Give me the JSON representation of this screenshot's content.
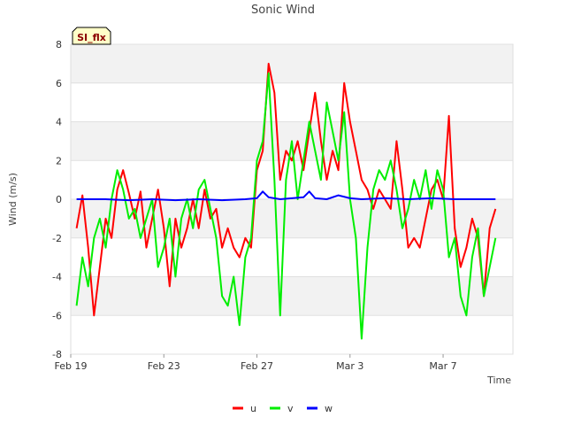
{
  "chart_data": {
    "type": "line",
    "title": "Sonic Wind",
    "xlabel": "Time",
    "ylabel": "Wind (m/s)",
    "badge": "SI_flx",
    "ylim": [
      -8,
      8
    ],
    "xlim": [
      "2023-02-19",
      "2023-03-10"
    ],
    "yticks": [
      -8,
      -6,
      -4,
      -2,
      0,
      2,
      4,
      6,
      8
    ],
    "xticks": [
      {
        "date": "2023-02-19",
        "label": "Feb 19"
      },
      {
        "date": "2023-02-23",
        "label": "Feb 23"
      },
      {
        "date": "2023-02-27",
        "label": "Feb 27"
      },
      {
        "date": "2023-03-03",
        "label": "Mar 3"
      },
      {
        "date": "2023-03-07",
        "label": "Mar 7"
      }
    ],
    "grid": true,
    "legend_position": "bottom",
    "series": [
      {
        "name": "u",
        "color": "#ff0000",
        "x": [
          "2023-02-19T06:00",
          "2023-02-19T12:00",
          "2023-02-19T18:00",
          "2023-02-20T00:00",
          "2023-02-20T06:00",
          "2023-02-20T12:00",
          "2023-02-20T18:00",
          "2023-02-21T00:00",
          "2023-02-21T06:00",
          "2023-02-21T12:00",
          "2023-02-21T18:00",
          "2023-02-22T00:00",
          "2023-02-22T06:00",
          "2023-02-22T12:00",
          "2023-02-22T18:00",
          "2023-02-23T00:00",
          "2023-02-23T06:00",
          "2023-02-23T12:00",
          "2023-02-23T18:00",
          "2023-02-24T00:00",
          "2023-02-24T06:00",
          "2023-02-24T12:00",
          "2023-02-24T18:00",
          "2023-02-25T00:00",
          "2023-02-25T06:00",
          "2023-02-25T12:00",
          "2023-02-25T18:00",
          "2023-02-26T00:00",
          "2023-02-26T06:00",
          "2023-02-26T12:00",
          "2023-02-26T18:00",
          "2023-02-27T00:00",
          "2023-02-27T06:00",
          "2023-02-27T12:00",
          "2023-02-27T18:00",
          "2023-02-28T00:00",
          "2023-02-28T06:00",
          "2023-02-28T12:00",
          "2023-02-28T18:00",
          "2023-03-01T00:00",
          "2023-03-01T06:00",
          "2023-03-01T12:00",
          "2023-03-01T18:00",
          "2023-03-02T00:00",
          "2023-03-02T06:00",
          "2023-03-02T12:00",
          "2023-03-02T18:00",
          "2023-03-03T00:00",
          "2023-03-03T06:00",
          "2023-03-03T12:00",
          "2023-03-03T18:00",
          "2023-03-04T00:00",
          "2023-03-04T06:00",
          "2023-03-04T12:00",
          "2023-03-04T18:00",
          "2023-03-05T00:00",
          "2023-03-05T06:00",
          "2023-03-05T12:00",
          "2023-03-05T18:00",
          "2023-03-06T00:00",
          "2023-03-06T06:00",
          "2023-03-06T12:00",
          "2023-03-06T18:00",
          "2023-03-07T00:00",
          "2023-03-07T06:00",
          "2023-03-07T12:00",
          "2023-03-07T18:00",
          "2023-03-08T00:00",
          "2023-03-08T06:00",
          "2023-03-08T12:00",
          "2023-03-08T18:00",
          "2023-03-09T00:00",
          "2023-03-09T06:00"
        ],
        "values": [
          -1.5,
          0.2,
          -2.5,
          -6.0,
          -3.5,
          -1.0,
          -2.0,
          0.5,
          1.5,
          0.3,
          -1.0,
          0.4,
          -2.5,
          -1.0,
          0.5,
          -1.5,
          -4.5,
          -1.0,
          -2.5,
          -1.5,
          0.0,
          -1.5,
          0.5,
          -1.0,
          -0.5,
          -2.5,
          -1.5,
          -2.5,
          -3.0,
          -2.0,
          -2.5,
          1.5,
          2.5,
          7.0,
          5.5,
          1.0,
          2.5,
          2.0,
          3.0,
          1.5,
          3.5,
          5.5,
          3.0,
          1.0,
          2.5,
          1.5,
          6.0,
          4.0,
          2.5,
          1.0,
          0.5,
          -0.5,
          0.5,
          0.0,
          -0.5,
          3.0,
          0.5,
          -2.5,
          -2.0,
          -2.5,
          -1.0,
          0.5,
          1.0,
          0.0,
          4.3,
          -1.5,
          -3.5,
          -2.5,
          -1.0,
          -2.0,
          -5.0,
          -1.5,
          -0.5
        ]
      },
      {
        "name": "v",
        "color": "#00ee00",
        "x": [
          "2023-02-19T06:00",
          "2023-02-19T12:00",
          "2023-02-19T18:00",
          "2023-02-20T00:00",
          "2023-02-20T06:00",
          "2023-02-20T12:00",
          "2023-02-20T18:00",
          "2023-02-21T00:00",
          "2023-02-21T06:00",
          "2023-02-21T12:00",
          "2023-02-21T18:00",
          "2023-02-22T00:00",
          "2023-02-22T06:00",
          "2023-02-22T12:00",
          "2023-02-22T18:00",
          "2023-02-23T00:00",
          "2023-02-23T06:00",
          "2023-02-23T12:00",
          "2023-02-23T18:00",
          "2023-02-24T00:00",
          "2023-02-24T06:00",
          "2023-02-24T12:00",
          "2023-02-24T18:00",
          "2023-02-25T00:00",
          "2023-02-25T06:00",
          "2023-02-25T12:00",
          "2023-02-25T18:00",
          "2023-02-26T00:00",
          "2023-02-26T06:00",
          "2023-02-26T12:00",
          "2023-02-26T18:00",
          "2023-02-27T00:00",
          "2023-02-27T06:00",
          "2023-02-27T12:00",
          "2023-02-27T18:00",
          "2023-02-28T00:00",
          "2023-02-28T06:00",
          "2023-02-28T12:00",
          "2023-02-28T18:00",
          "2023-03-01T00:00",
          "2023-03-01T06:00",
          "2023-03-01T12:00",
          "2023-03-01T18:00",
          "2023-03-02T00:00",
          "2023-03-02T06:00",
          "2023-03-02T12:00",
          "2023-03-02T18:00",
          "2023-03-03T00:00",
          "2023-03-03T06:00",
          "2023-03-03T12:00",
          "2023-03-03T18:00",
          "2023-03-04T00:00",
          "2023-03-04T06:00",
          "2023-03-04T12:00",
          "2023-03-04T18:00",
          "2023-03-05T00:00",
          "2023-03-05T06:00",
          "2023-03-05T12:00",
          "2023-03-05T18:00",
          "2023-03-06T00:00",
          "2023-03-06T06:00",
          "2023-03-06T12:00",
          "2023-03-06T18:00",
          "2023-03-07T00:00",
          "2023-03-07T06:00",
          "2023-03-07T12:00",
          "2023-03-07T18:00",
          "2023-03-08T00:00",
          "2023-03-08T06:00",
          "2023-03-08T12:00",
          "2023-03-08T18:00",
          "2023-03-09T00:00",
          "2023-03-09T06:00"
        ],
        "values": [
          -5.5,
          -3.0,
          -4.5,
          -2.0,
          -1.0,
          -2.5,
          0.0,
          1.5,
          0.5,
          -1.0,
          -0.5,
          -2.0,
          -1.0,
          0.0,
          -3.5,
          -2.5,
          -1.0,
          -4.0,
          -1.0,
          0.0,
          -1.5,
          0.5,
          1.0,
          -0.5,
          -2.0,
          -5.0,
          -5.5,
          -4.0,
          -6.5,
          -3.0,
          -2.0,
          2.0,
          3.0,
          6.5,
          1.0,
          -6.0,
          1.0,
          3.0,
          0.0,
          2.0,
          4.0,
          2.5,
          1.0,
          5.0,
          3.5,
          2.0,
          4.5,
          0.0,
          -2.0,
          -7.2,
          -2.5,
          0.5,
          1.5,
          1.0,
          2.0,
          0.5,
          -1.5,
          -0.5,
          1.0,
          0.0,
          1.5,
          -0.5,
          1.5,
          0.5,
          -3.0,
          -2.0,
          -5.0,
          -6.0,
          -3.0,
          -1.5,
          -5.0,
          -3.5,
          -2.0
        ]
      },
      {
        "name": "w",
        "color": "#0000ff",
        "x": [
          "2023-02-19T06:00",
          "2023-02-20T12:00",
          "2023-02-21T12:00",
          "2023-02-22T12:00",
          "2023-02-23T12:00",
          "2023-02-24T12:00",
          "2023-02-25T12:00",
          "2023-02-26T12:00",
          "2023-02-27T00:00",
          "2023-02-27T06:00",
          "2023-02-27T12:00",
          "2023-02-28T00:00",
          "2023-02-28T12:00",
          "2023-03-01T00:00",
          "2023-03-01T06:00",
          "2023-03-01T12:00",
          "2023-03-02T00:00",
          "2023-03-02T12:00",
          "2023-03-03T00:00",
          "2023-03-03T12:00",
          "2023-03-04T12:00",
          "2023-03-05T12:00",
          "2023-03-06T12:00",
          "2023-03-07T12:00",
          "2023-03-08T12:00",
          "2023-03-09T06:00"
        ],
        "values": [
          0.0,
          0.0,
          -0.05,
          0.0,
          -0.05,
          0.0,
          -0.05,
          0.0,
          0.05,
          0.4,
          0.1,
          0.0,
          0.05,
          0.1,
          0.4,
          0.05,
          0.0,
          0.2,
          0.05,
          0.0,
          0.05,
          0.0,
          0.05,
          0.0,
          0.0,
          0.0
        ]
      }
    ]
  }
}
